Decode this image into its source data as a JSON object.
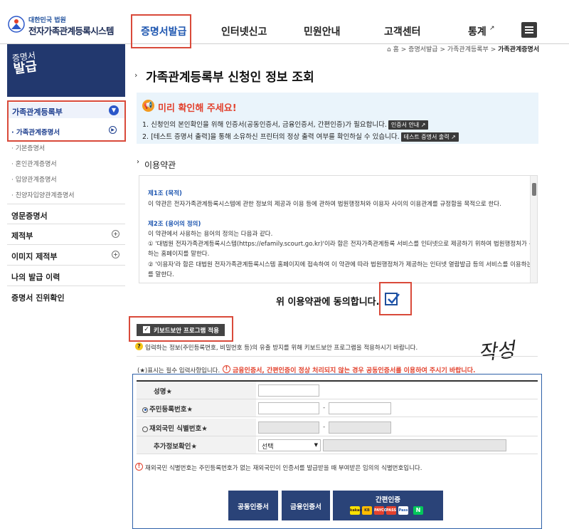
{
  "header": {
    "org_small": "대한민국 법원",
    "system_name": "전자가족관계등록시스템",
    "nav": [
      "증명서발급",
      "인터넷신고",
      "민원안내",
      "고객센터",
      "통계"
    ]
  },
  "sidebar": {
    "banner_line1": "증명서",
    "banner_line2": "발급",
    "group_title": "가족관계등록부",
    "group_items": [
      "가족관계증명서",
      "기본증명서",
      "혼인관계증명서",
      "입양관계증명서",
      "친양자입양관계증명서"
    ],
    "menus": [
      "영문증명서",
      "제적부",
      "이미지 제적부",
      "나의 발급 이력",
      "증명서 진위확인"
    ]
  },
  "breadcrumb": {
    "home": "홈",
    "level1": "증명서발급",
    "level2": "가족관계등록부",
    "current": "가족관계증명서",
    "sep": ">"
  },
  "page_title": "가족관계등록부 신청인 정보 조회",
  "notice": {
    "title": "미리 확인해 주세요!",
    "line1": "1. 신청인의 본인확인을 위해 인증서(공동인증서, 금융인증서, 간편인증)가 필요합니다.",
    "btn1": "인증서 안내",
    "line2": "2. [테스트 증명서 출력]을 통해 소유하신 프린터의 정상 출력 여부를 확인하실 수 있습니다.",
    "btn2": "테스트 증명서 출력"
  },
  "terms": {
    "section_title": "이용약관",
    "art1_title": "제1조 (목적)",
    "art1_text": "이 약관은 전자가족관계등록시스템에 관한 정보의 제공과 이용 등에 관하여 법원행정처와 이용자 사이의 이용관계를 규정함을 목적으로 한다.",
    "art2_title": "제2조 (용어의 정의)",
    "art2_intro": "이 약관에서 사용하는 용어의 정의는 다음과 같다.",
    "art2_item1a": "① '대법원 전자가족관계등록시스템(https://efamily.scourt.go.kr)'이라 함은 전자가족관계등록 서비스를 인터넷으로 제공하기 위하여 법원행정처가 구축하고 운영",
    "art2_item1b": "하는 홈페이지를 말한다.",
    "art2_item2a": "② '이용자'라 함은 대법원 전자가족관계등록시스템 홈페이지에 접속하여 이 약관에 따라 법원행정처가 제공하는 인터넷 열람발급 등의 서비스를 이용하는 자",
    "art2_item2b": "를 말한다."
  },
  "agree": {
    "label": "위 이용약관에 동의합니다.",
    "checked": true
  },
  "keyboard_security": {
    "label": "키보드보안 프로그램 적용",
    "checked": true
  },
  "kb_info": "입력하는 정보(주민등록번호, 비밀번호 등)의 유출 방지를 위해 키보드보안 프로그램을 적용하시기 바랍니다.",
  "handwriting": "작성",
  "required_note": "(★)표시는 필수 입력사항입니다.",
  "warning": "금융인증서, 간편인증이 정상 처리되지 않는 경우 공동인증서를 이용하여 주시기 바랍니다.",
  "form": {
    "name_label": "성명★",
    "rrn_label": "주민등록번호★",
    "foreigner_label": "재외국민 식별번호★",
    "extra_label": "추가정보확인★",
    "select_value": "선택",
    "dash": "-",
    "rrn_selected": true
  },
  "foreigner_note": "재외국민 식별번호는 주민등록번호가 없는 재외국민이 인증서를 발급받을 때 부여받은 임의의 식별번호입니다.",
  "cert_buttons": {
    "joint": "공동인증서",
    "financial": "금융인증서",
    "simple": "간편인증"
  },
  "simple_logos": [
    "kakao",
    "KB",
    "PAYCO",
    "PASS",
    "Pass",
    "N"
  ],
  "colors": {
    "brand_blue": "#1e3f8f",
    "highlight_red": "#d94a3a",
    "button_navy": "#2a4378",
    "notice_bg": "#eaf4fb"
  }
}
